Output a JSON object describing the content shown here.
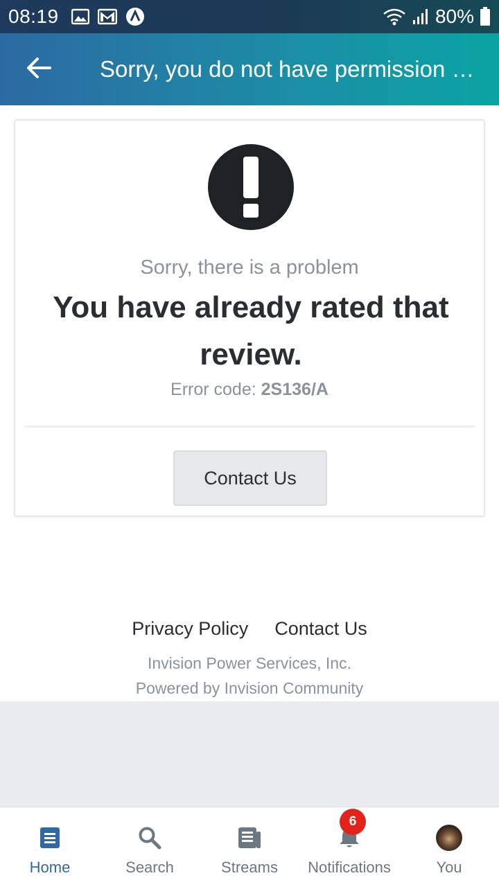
{
  "status_bar": {
    "time": "08:19",
    "battery": "80%",
    "left_icons": [
      "gallery-icon",
      "gmail-icon",
      "app-icon"
    ],
    "right_icons": [
      "wifi-icon",
      "signal-icon",
      "battery-icon"
    ]
  },
  "app_bar": {
    "title": "Sorry, you do not have permission f…",
    "back_icon": "arrow-left-icon"
  },
  "error_card": {
    "icon": "exclamation-circle-icon",
    "subtitle": "Sorry, there is a problem",
    "message": "You have already rated that review.",
    "error_label": "Error code:",
    "error_code": "2S136/A",
    "contact_button": "Contact Us"
  },
  "footer": {
    "links": [
      "Privacy Policy",
      "Contact Us"
    ],
    "company": "Invision Power Services, Inc.",
    "powered_by": "Powered by Invision Community"
  },
  "bottom_nav": {
    "items": [
      {
        "label": "Home",
        "icon": "home-icon",
        "active": true
      },
      {
        "label": "Search",
        "icon": "search-icon",
        "active": false
      },
      {
        "label": "Streams",
        "icon": "streams-icon",
        "active": false
      },
      {
        "label": "Notifications",
        "icon": "bell-icon",
        "active": false,
        "badge": "6"
      },
      {
        "label": "You",
        "icon": "avatar",
        "active": false
      }
    ]
  },
  "colors": {
    "accent": "#2f6aa5",
    "badge": "#e2231a",
    "muted_text": "#8a929c"
  }
}
